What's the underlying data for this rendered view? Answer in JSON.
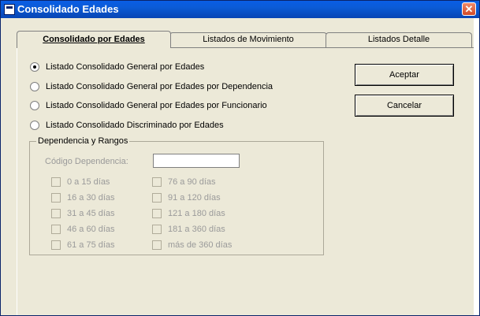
{
  "window": {
    "title": "Consolidado Edades",
    "close_label": "✕"
  },
  "tabs": [
    {
      "label": "Consolidado por Edades",
      "active": true
    },
    {
      "label": "Listados de Movimiento",
      "active": false
    },
    {
      "label": "Listados Detalle",
      "active": false
    }
  ],
  "options": [
    {
      "label": "Listado Consolidado General por Edades",
      "selected": true
    },
    {
      "label": "Listado Consolidado General por Edades por Dependencia",
      "selected": false
    },
    {
      "label": "Listado Consolidado General por Edades por Funcionario",
      "selected": false
    },
    {
      "label": "Listado Consolidado Discriminado por Edades",
      "selected": false
    }
  ],
  "buttons": {
    "accept": "Aceptar",
    "cancel": "Cancelar"
  },
  "group": {
    "title": "Dependencia y Rangos",
    "code_label": "Código Dependencia:",
    "code_value": "",
    "ranges_left": [
      "0 a 15 días",
      "16 a 30 días",
      "31 a 45 días",
      "46 a 60 días",
      "61 a 75 días"
    ],
    "ranges_right": [
      "76 a 90 días",
      "91 a 120 días",
      "121 a 180 días",
      "181 a 360 días",
      "más de 360 días"
    ]
  },
  "colors": {
    "titlebar": "#0a5ee6",
    "face": "#ece9d8",
    "disabled_text": "#9a9a9a"
  }
}
